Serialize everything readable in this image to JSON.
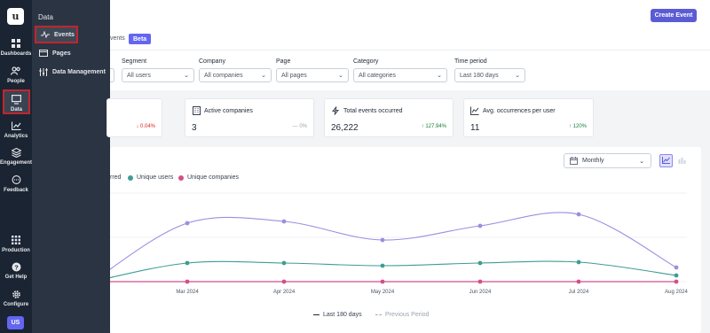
{
  "rail": {
    "logo": "u",
    "items": [
      {
        "label": "Dashboards",
        "icon": "grid-icon"
      },
      {
        "label": "People",
        "icon": "people-icon"
      },
      {
        "label": "Data",
        "icon": "data-icon"
      },
      {
        "label": "Analytics",
        "icon": "analytics-icon"
      },
      {
        "label": "Engagement",
        "icon": "layers-icon"
      },
      {
        "label": "Feedback",
        "icon": "chat-icon"
      },
      {
        "label": "Production",
        "icon": "apps-icon"
      },
      {
        "label": "Get Help",
        "icon": "help-icon"
      },
      {
        "label": "Configure",
        "icon": "gear-icon"
      }
    ],
    "avatar": "US"
  },
  "flyout": {
    "heading": "Data",
    "items": [
      {
        "label": "Events",
        "icon": "pulse-icon"
      },
      {
        "label": "Pages",
        "icon": "page-icon"
      },
      {
        "label": "Data Management",
        "icon": "sliders-icon"
      }
    ]
  },
  "header": {
    "create_button": "Create Event",
    "tab_partial": "vents",
    "beta_badge": "Beta"
  },
  "filters": [
    {
      "label": "Segment",
      "value": "All users"
    },
    {
      "label": "Company",
      "value": "All companies"
    },
    {
      "label": "Page",
      "value": "All pages"
    },
    {
      "label": "Category",
      "value": "All categories"
    },
    {
      "label": "Time period",
      "value": "Last 180 days"
    }
  ],
  "cards": [
    {
      "title": "",
      "value": "",
      "delta": "0.04%",
      "trend": "down"
    },
    {
      "title": "Active companies",
      "value": "3",
      "delta": "0%",
      "trend": "flat"
    },
    {
      "title": "Total events occurred",
      "value": "26,222",
      "delta": "127.94%",
      "trend": "up"
    },
    {
      "title": "Avg. occurrences per user",
      "value": "11",
      "delta": "120%",
      "trend": "up"
    }
  ],
  "chart_controls": {
    "period": "Monthly"
  },
  "legend": {
    "partial": "rred",
    "unique_users": "Unique users",
    "unique_companies": "Unique companies",
    "last_period": "Last 180 days",
    "previous_period": "Previous Period"
  },
  "colors": {
    "events": "#9b8ee0",
    "users": "#3f9c93",
    "companies": "#d44d8c",
    "accent": "#5b5bd6"
  },
  "chart_data": {
    "type": "line",
    "categories": [
      "",
      "Mar 2024",
      "Apr 2024",
      "May 2024",
      "Jun 2024",
      "Jul 2024",
      "Aug 2024"
    ],
    "series": [
      {
        "name": "",
        "values": [
          null,
          0.66,
          0.68,
          0.47,
          0.63,
          0.76,
          0.16
        ]
      },
      {
        "name": "Unique users",
        "values": [
          null,
          0.21,
          0.21,
          0.18,
          0.21,
          0.22,
          0.07
        ]
      },
      {
        "name": "Unique companies",
        "values": [
          null,
          0.0,
          0.0,
          0.0,
          0.0,
          0.0,
          0.0
        ]
      }
    ]
  }
}
